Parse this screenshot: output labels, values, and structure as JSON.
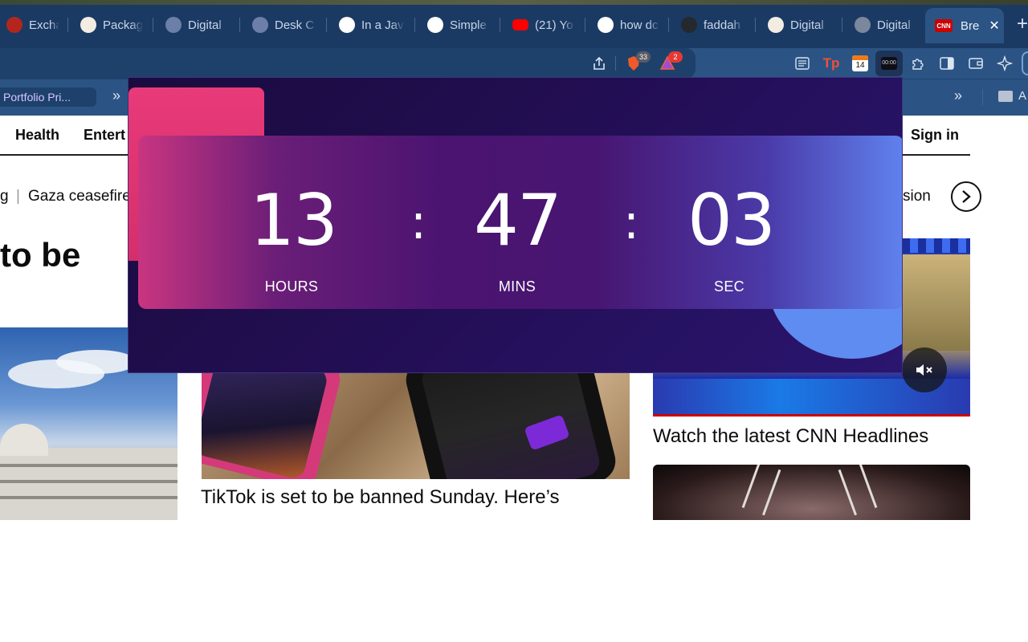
{
  "browser": {
    "tabs": [
      {
        "label": "Exchan",
        "icon": "exchange-favicon-icon"
      },
      {
        "label": "Packag",
        "icon": "package-favicon-icon"
      },
      {
        "label": "Digital",
        "icon": "app-favicon-icon"
      },
      {
        "label": "Desk C",
        "icon": "app-favicon-icon"
      },
      {
        "label": "In a Jav",
        "icon": "google-favicon-icon"
      },
      {
        "label": "Simple",
        "icon": "codepen-favicon-icon"
      },
      {
        "label": "(21) Yo",
        "icon": "youtube-favicon-icon"
      },
      {
        "label": "how dc",
        "icon": "google-favicon-icon"
      },
      {
        "label": "faddah",
        "icon": "github-favicon-icon"
      },
      {
        "label": "Digital",
        "icon": "package-favicon-icon"
      },
      {
        "label": "Digital",
        "icon": "globe-favicon-icon"
      }
    ],
    "active_tab": {
      "label": "Bre",
      "favicon_text": "CNN"
    },
    "brave_shields_count": "33",
    "rewards_count": "2",
    "calendar_day": "14",
    "bookmarks": {
      "portfolio": "Portfolio Pri..."
    },
    "bookmarks_right": "A"
  },
  "site": {
    "nav": {
      "health": "Health",
      "entertainment": "Entert",
      "sign_in": "Sign in"
    },
    "ticker": {
      "left_fragment": "g",
      "gaza": "Gaza ceasefire",
      "right_fragment": "sion"
    },
    "headline_fragment": "to be",
    "tiktok_headline": "TikTok is set to be banned Sunday. Here’s",
    "video_headline": "Watch the latest CNN Headlines"
  },
  "timer": {
    "hours": "13",
    "minutes": "47",
    "seconds": "03",
    "hours_label": "HOURS",
    "minutes_label": "MINS",
    "seconds_label": "SEC",
    "separator": ":"
  },
  "colors": {
    "popup_bg": "#1a0b3f",
    "pink_accent": "#e83a78",
    "blue_accent": "#5f8cf1",
    "cnn_red": "#cc0000"
  }
}
